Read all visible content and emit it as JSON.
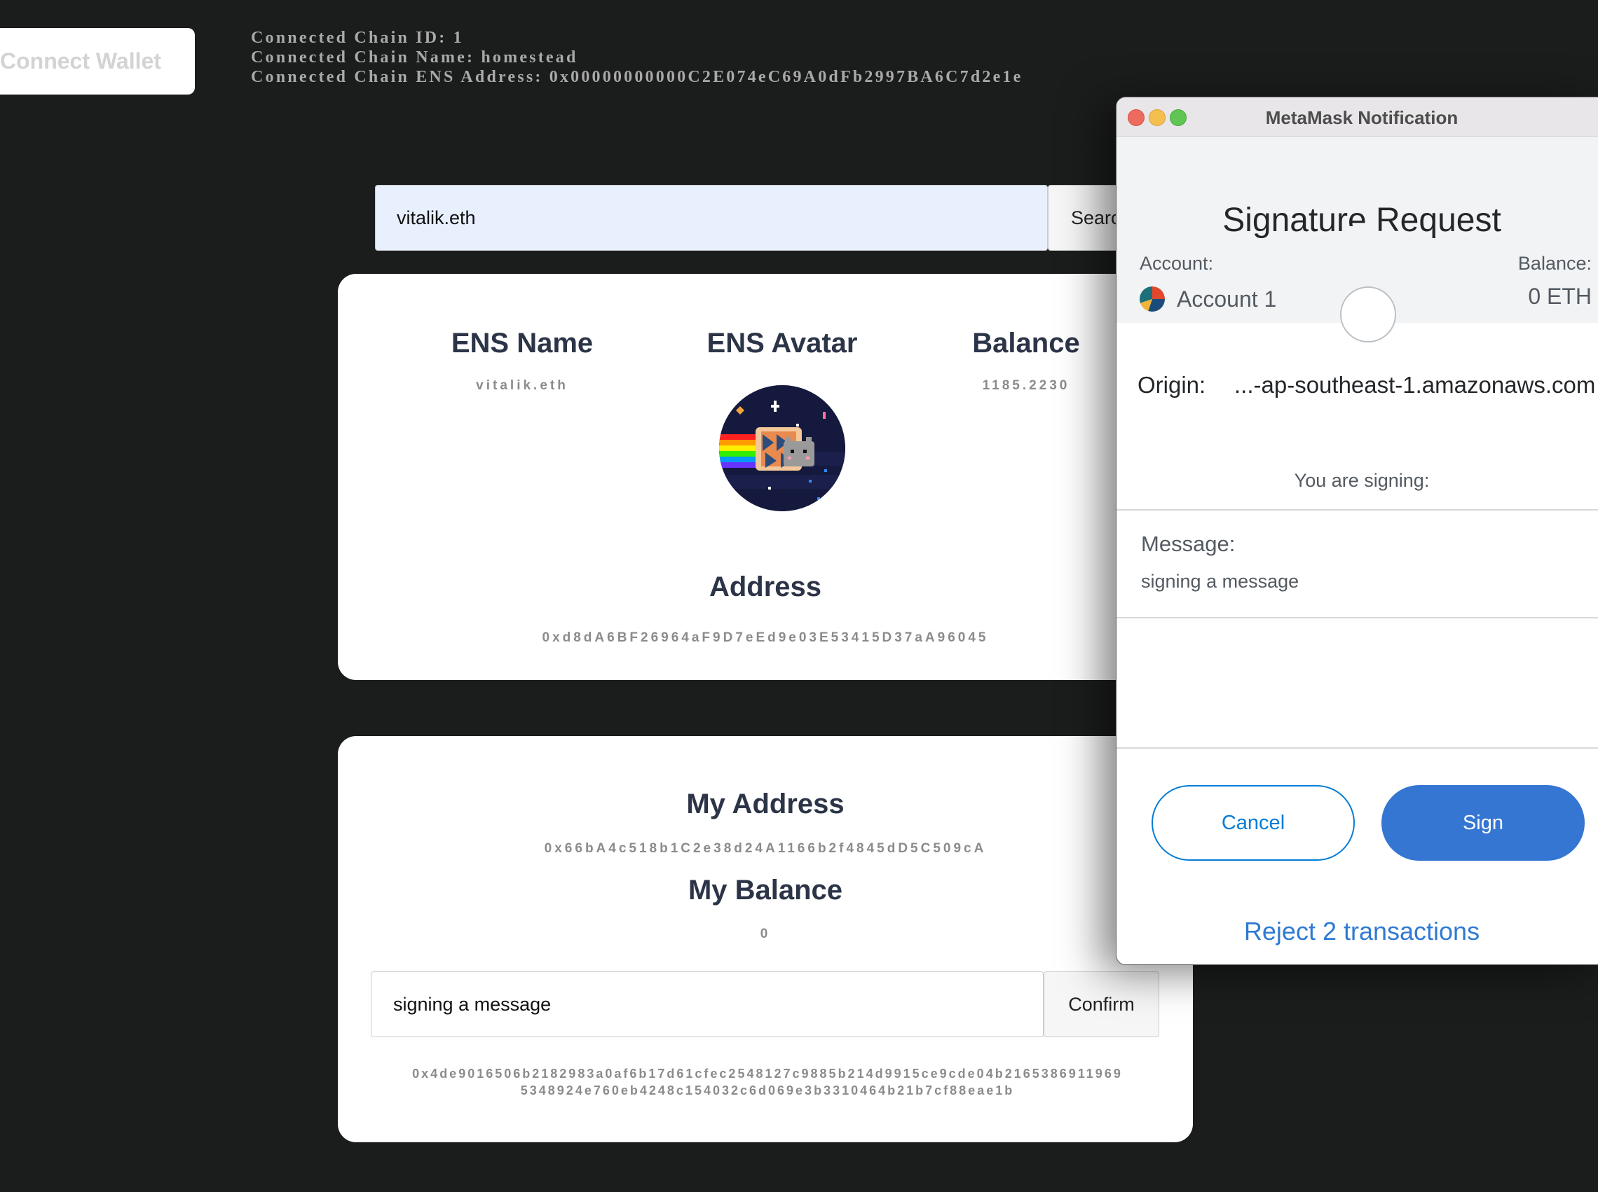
{
  "top": {
    "connect_label": "Connect Wallet",
    "chain_id": "Connected Chain ID: 1",
    "chain_name": "Connected Chain Name: homestead",
    "chain_ens": "Connected Chain ENS Address: 0x00000000000C2E074eC69A0dFb2997BA6C7d2e1e"
  },
  "search": {
    "value": "vitalik.eth",
    "button_label": "Search"
  },
  "ens_card": {
    "name_heading": "ENS Name",
    "name_value": "vitalik.eth",
    "avatar_heading": "ENS Avatar",
    "balance_heading": "Balance",
    "balance_value": "1185.2230",
    "address_heading": "Address",
    "address_value": "0xd8dA6BF26964aF9D7eEd9e03E53415D37aA96045"
  },
  "my_card": {
    "address_heading": "My Address",
    "address_value": "0x66bA4c518b1C2e38d24A1166b2f4845dD5C509cA",
    "balance_heading": "My Balance",
    "balance_value": "0",
    "message_value": "signing a message",
    "confirm_label": "Confirm",
    "signature_line1": "0x4de9016506b2182983a0af6b17d61cfec2548127c9885b214d9915ce9cde04b2165386911969",
    "signature_line2": "5348924e760eb4248c154032c6d069e3b3310464b21b7cf88eae1b"
  },
  "metamask": {
    "window_title": "MetaMask Notification",
    "header_title": "Signature Request",
    "account_label": "Account:",
    "account_name": "Account 1",
    "balance_label": "Balance:",
    "balance_value": "0 ETH",
    "origin_label": "Origin:",
    "origin_value": "...-ap-southeast-1.amazonaws.com",
    "signing_label": "You are signing:",
    "message_label": "Message:",
    "message_value": "signing a message",
    "cancel_label": "Cancel",
    "sign_label": "Sign",
    "reject_label": "Reject 2 transactions"
  }
}
